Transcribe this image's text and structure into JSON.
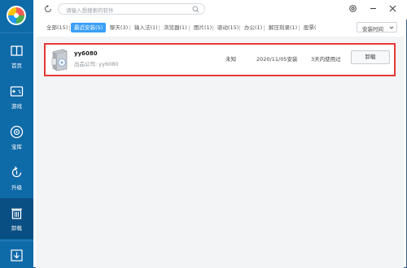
{
  "colors": {
    "sidebar": "#0f6aa8",
    "sidebar_active": "#0a4f83",
    "accent": "#3a9ff5",
    "highlight": "#e53935"
  },
  "sidebar": {
    "items": [
      {
        "label": "首页",
        "icon": "home-icon"
      },
      {
        "label": "游戏",
        "icon": "gamepad-icon"
      },
      {
        "label": "宝库",
        "icon": "treasure-icon"
      },
      {
        "label": "升级",
        "icon": "upgrade-icon"
      },
      {
        "label": "卸载",
        "icon": "trash-icon",
        "active": true
      },
      {
        "label": "",
        "icon": "download-icon"
      }
    ]
  },
  "search": {
    "placeholder": "请输入想搜索的软件"
  },
  "tabs": [
    {
      "label": "全部(15)"
    },
    {
      "label": "最近安装(5)",
      "active": true
    },
    {
      "label": "聊天(3)"
    },
    {
      "label": "输入法(1)"
    },
    {
      "label": "浏览器(1)"
    },
    {
      "label": "图片(1)"
    },
    {
      "label": "驱动(15)"
    },
    {
      "label": "办公(1)"
    },
    {
      "label": "解压刻录(1)"
    },
    {
      "label": "股票("
    }
  ],
  "sort": {
    "label": "安装时间"
  },
  "apps": [
    {
      "name": "yy6080",
      "publisher": "出品公司: yy6080",
      "size": "未知",
      "install_date": "2020/11/05安装",
      "usage": "3天内使用过",
      "uninstall_label": "卸载"
    }
  ]
}
